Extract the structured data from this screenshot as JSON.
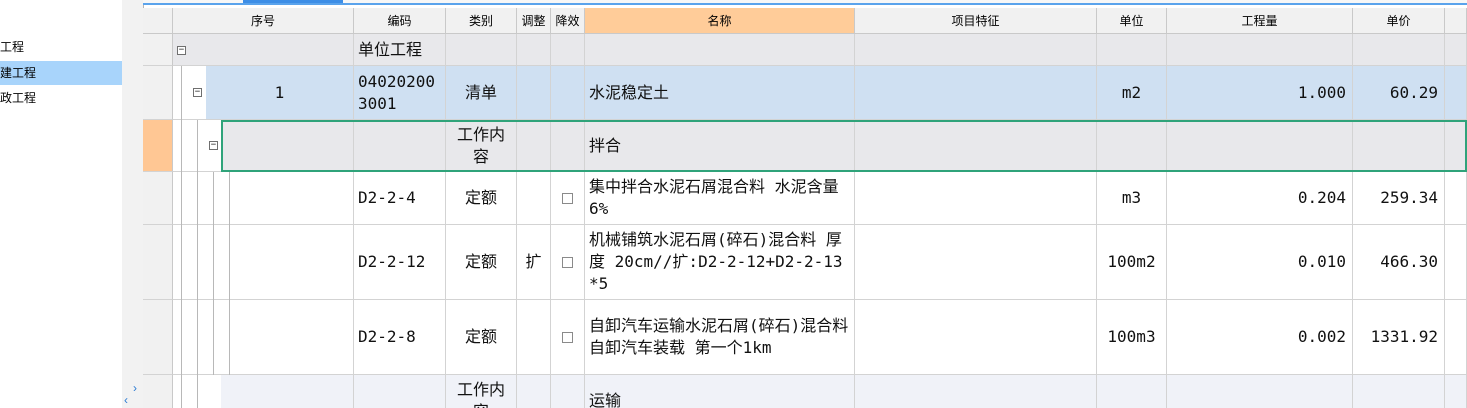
{
  "left_tree": {
    "items": [
      {
        "label": "项工程",
        "selected": false
      },
      {
        "label": "土建工程",
        "selected": true
      },
      {
        "label": "市政工程",
        "selected": false
      }
    ]
  },
  "grid": {
    "columns": [
      {
        "key": "seq",
        "label": "序号"
      },
      {
        "key": "code",
        "label": "编码"
      },
      {
        "key": "type",
        "label": "类别"
      },
      {
        "key": "adjust",
        "label": "调整"
      },
      {
        "key": "reduce",
        "label": "降效"
      },
      {
        "key": "name",
        "label": "名称"
      },
      {
        "key": "feature",
        "label": "项目特征"
      },
      {
        "key": "unit",
        "label": "单位"
      },
      {
        "key": "qty",
        "label": "工程量"
      },
      {
        "key": "price",
        "label": "单价"
      }
    ],
    "rows": [
      {
        "style": "gray",
        "seq": "",
        "code": "单位工程",
        "type": "",
        "adjust": "",
        "reduce": "",
        "checkbox": false,
        "name": "",
        "feature": "",
        "unit": "",
        "qty": "",
        "price": ""
      },
      {
        "style": "blue",
        "seq": "1",
        "code": "040202003001",
        "type": "清单",
        "adjust": "",
        "reduce": "",
        "checkbox": false,
        "name": "水泥稳定土",
        "feature": "",
        "unit": "m2",
        "qty": "1.000",
        "price": "60.29"
      },
      {
        "style": "gray",
        "seq": "",
        "code": "",
        "type": "工作内容",
        "adjust": "",
        "reduce": "",
        "checkbox": false,
        "name": "拌合",
        "feature": "",
        "unit": "",
        "qty": "",
        "price": ""
      },
      {
        "style": "white",
        "seq": "",
        "code": "D2-2-4",
        "type": "定额",
        "adjust": "",
        "reduce": "",
        "checkbox": true,
        "name": "集中拌合水泥石屑混合料 水泥含量 6%",
        "feature": "",
        "unit": "m3",
        "qty": "0.204",
        "price": "259.34"
      },
      {
        "style": "white",
        "seq": "",
        "code": "D2-2-12",
        "type": "定额",
        "adjust": "扩",
        "reduce": "",
        "checkbox": true,
        "name": "机械铺筑水泥石屑(碎石)混合料 厚度 20cm//扩:D2-2-12+D2-2-13*5",
        "feature": "",
        "unit": "100m2",
        "qty": "0.010",
        "price": "466.30"
      },
      {
        "style": "white",
        "seq": "",
        "code": "D2-2-8",
        "type": "定额",
        "adjust": "",
        "reduce": "",
        "checkbox": true,
        "name": "自卸汽车运输水泥石屑(碎石)混合料 自卸汽车装载 第一个1km",
        "feature": "",
        "unit": "100m3",
        "qty": "0.002",
        "price": "1331.92"
      },
      {
        "style": "light",
        "seq": "",
        "code": "",
        "type": "工作内容",
        "adjust": "",
        "reduce": "",
        "checkbox": false,
        "name": "运输",
        "feature": "",
        "unit": "",
        "qty": "",
        "price": ""
      }
    ]
  },
  "colors": {
    "selected_tree": "#a8d4fb",
    "name_header": "#ffcc99",
    "list_row": "#cfe0f2",
    "focus_border": "#2fa37a"
  }
}
